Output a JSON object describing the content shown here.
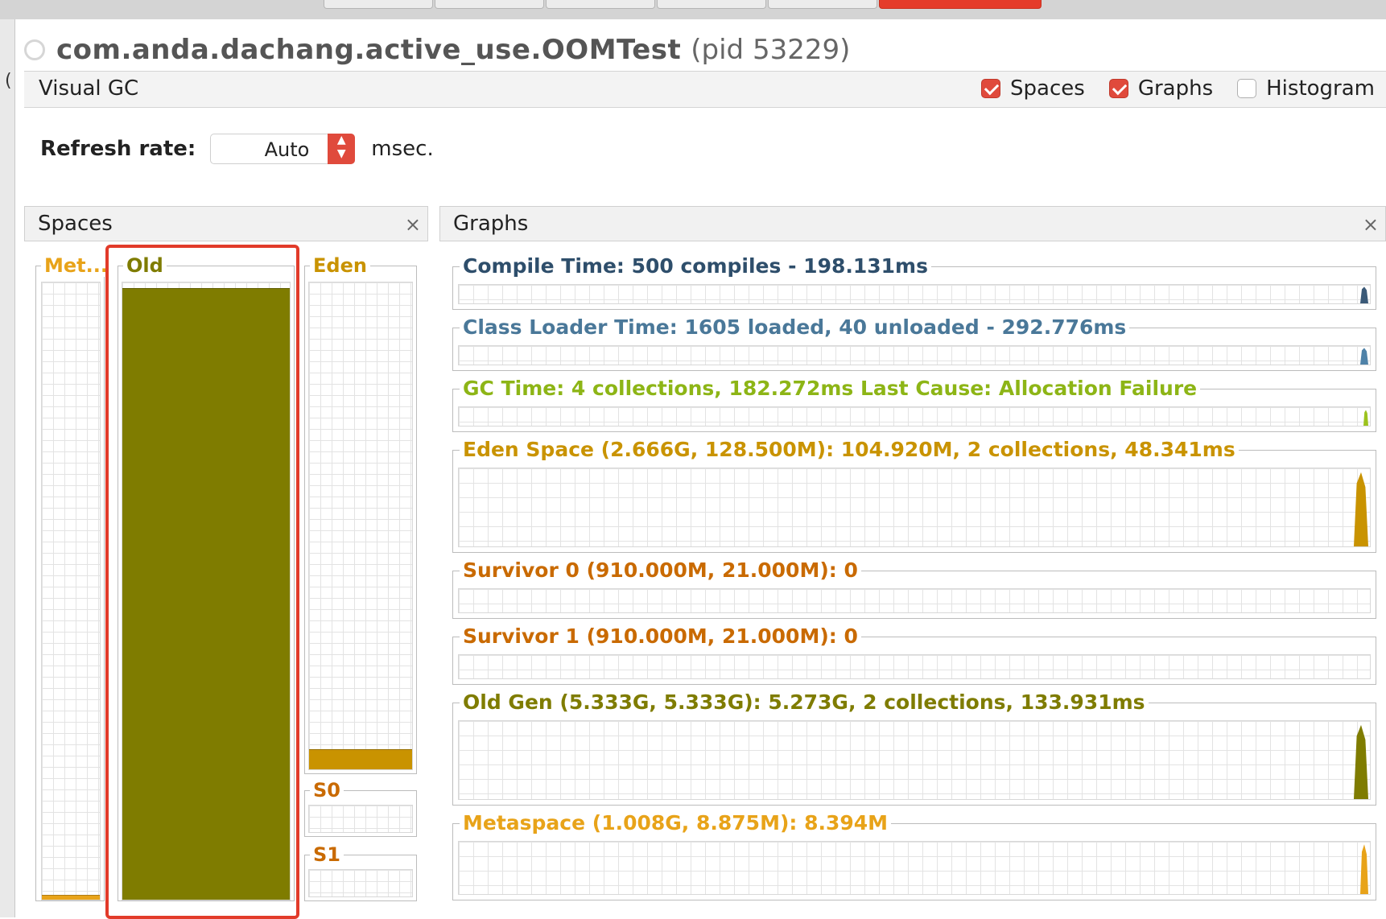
{
  "header": {
    "process_name": "com.anda.dachang.active_use.OOMTest",
    "pid_text": "(pid 53229)"
  },
  "left_stray_char": "(",
  "visual_gc": {
    "title": "Visual GC",
    "checks": [
      {
        "label": "Spaces",
        "checked": true
      },
      {
        "label": "Graphs",
        "checked": true
      },
      {
        "label": "Histogram",
        "checked": false
      }
    ]
  },
  "refresh": {
    "label": "Refresh rate:",
    "value": "Auto",
    "unit": "msec."
  },
  "spaces_panel": {
    "title": "Spaces",
    "close": "×",
    "metaspace": {
      "label": "Met...",
      "color": "#e8a319",
      "fill_fraction": 0.006
    },
    "old": {
      "label": "Old",
      "color": "#7f7c00",
      "fill_fraction": 0.99
    },
    "eden": {
      "label": "Eden",
      "color": "#c99300",
      "fill_fraction": 0.04
    },
    "s0": {
      "label": "S0",
      "color": "#c96a00",
      "fill_fraction": 0
    },
    "s1": {
      "label": "S1",
      "color": "#c96a00",
      "fill_fraction": 0
    }
  },
  "graphs_panel": {
    "title": "Graphs",
    "close": "×",
    "graphs": [
      {
        "title": "Compile Time: 500 compiles - 198.131ms",
        "color": "#2e4e6b",
        "spike_color": "#3b5a78",
        "level": 0.9
      },
      {
        "title": "Class Loader Time: 1605 loaded, 40 unloaded - 292.776ms",
        "color": "#4a7899",
        "spike_color": "#4f82a8",
        "level": 0.9
      },
      {
        "title": "GC Time: 4 collections, 182.272ms Last Cause: Allocation Failure",
        "color": "#8db516",
        "spike_color": "#9cc31e",
        "level": 0.85
      },
      {
        "title": "Eden Space (2.666G, 128.500M): 104.920M, 2 collections, 48.341ms",
        "color": "#c99300",
        "spike_color": "#c99300",
        "level": 0.95
      },
      {
        "title": "Survivor 0 (910.000M, 21.000M): 0",
        "color": "#c96a00",
        "spike_color": "#c96a00",
        "level": 0
      },
      {
        "title": "Survivor 1 (910.000M, 21.000M): 0",
        "color": "#c96a00",
        "spike_color": "#c96a00",
        "level": 0
      },
      {
        "title": "Old Gen (5.333G, 5.333G): 5.273G, 2 collections, 133.931ms",
        "color": "#7f7c00",
        "spike_color": "#7f7c00",
        "level": 0.95
      },
      {
        "title": "Metaspace (1.008G, 8.875M): 8.394M",
        "color": "#e8a319",
        "spike_color": "#e8a319",
        "level": 0.95
      }
    ]
  }
}
